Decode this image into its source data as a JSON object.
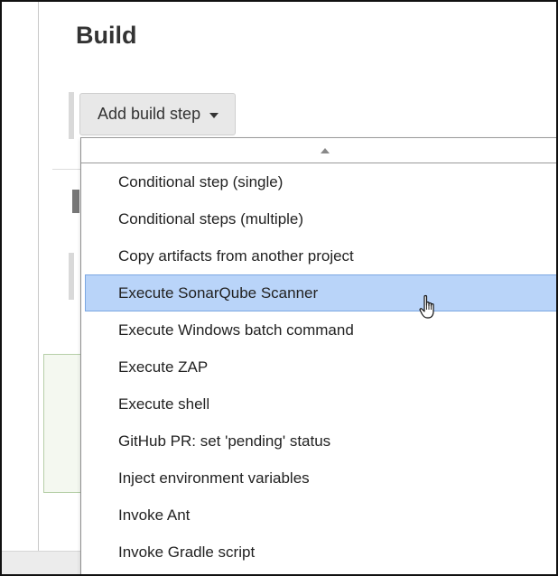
{
  "section": {
    "title": "Build"
  },
  "add_build_step": {
    "label": "Add build step"
  },
  "dropdown": {
    "items": [
      {
        "label": "Conditional step (single)"
      },
      {
        "label": "Conditional steps (multiple)"
      },
      {
        "label": "Copy artifacts from another project"
      },
      {
        "label": "Execute SonarQube Scanner"
      },
      {
        "label": "Execute Windows batch command"
      },
      {
        "label": "Execute ZAP"
      },
      {
        "label": "Execute shell"
      },
      {
        "label": "GitHub PR: set 'pending' status"
      },
      {
        "label": "Inject environment variables"
      },
      {
        "label": "Invoke Ant"
      },
      {
        "label": "Invoke Gradle script"
      }
    ],
    "highlighted_item": "Execute SonarQube Scanner",
    "highlight_color": "#b9d4f9"
  },
  "icons": {
    "caret": "caret-down-icon",
    "scroll_up": "scroll-up-arrow-icon",
    "cursor": "hand-pointer-cursor-icon"
  }
}
